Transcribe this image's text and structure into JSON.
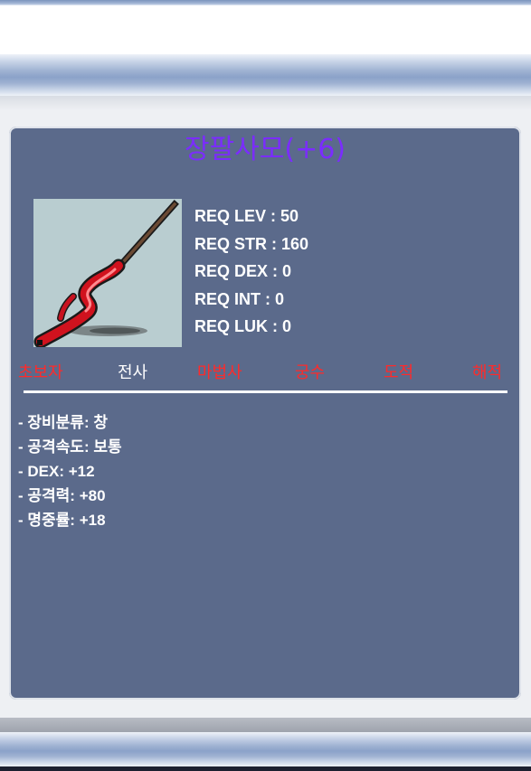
{
  "item": {
    "name": "장팔사모(+6)",
    "icon": "red-spear-icon",
    "requirements": [
      "REQ LEV : 50",
      "REQ STR : 160",
      "REQ DEX : 0",
      "REQ INT : 0",
      "REQ LUK : 0"
    ],
    "jobs": [
      {
        "label": "초보자",
        "allowed": false
      },
      {
        "label": "전사",
        "allowed": true
      },
      {
        "label": "마법사",
        "allowed": false
      },
      {
        "label": "궁수",
        "allowed": false
      },
      {
        "label": "도적",
        "allowed": false
      },
      {
        "label": "해적",
        "allowed": false
      }
    ],
    "stats": [
      "- 장비분류: 창",
      "- 공격속도: 보통",
      "- DEX: +12",
      "- 공격력: +80",
      "- 명중률: +18"
    ]
  },
  "colors": {
    "title": "#7b2cff",
    "panel": "#5b6a8b",
    "job_disallowed": "#ff2a2a",
    "job_allowed": "#ffffff"
  }
}
